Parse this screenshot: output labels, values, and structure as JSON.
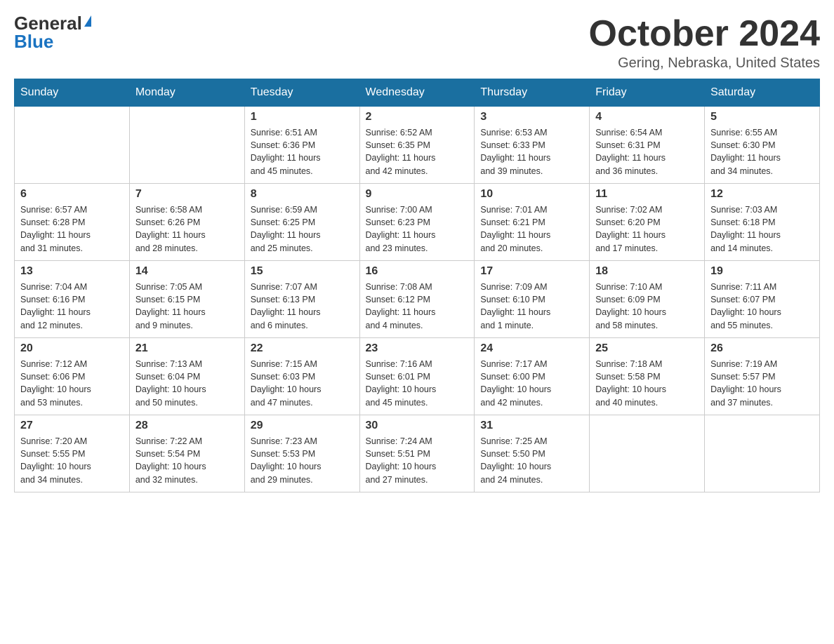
{
  "header": {
    "logo_general": "General",
    "logo_blue": "Blue",
    "title": "October 2024",
    "location": "Gering, Nebraska, United States"
  },
  "days_of_week": [
    "Sunday",
    "Monday",
    "Tuesday",
    "Wednesday",
    "Thursday",
    "Friday",
    "Saturday"
  ],
  "weeks": [
    [
      {
        "day": "",
        "info": ""
      },
      {
        "day": "",
        "info": ""
      },
      {
        "day": "1",
        "info": "Sunrise: 6:51 AM\nSunset: 6:36 PM\nDaylight: 11 hours\nand 45 minutes."
      },
      {
        "day": "2",
        "info": "Sunrise: 6:52 AM\nSunset: 6:35 PM\nDaylight: 11 hours\nand 42 minutes."
      },
      {
        "day": "3",
        "info": "Sunrise: 6:53 AM\nSunset: 6:33 PM\nDaylight: 11 hours\nand 39 minutes."
      },
      {
        "day": "4",
        "info": "Sunrise: 6:54 AM\nSunset: 6:31 PM\nDaylight: 11 hours\nand 36 minutes."
      },
      {
        "day": "5",
        "info": "Sunrise: 6:55 AM\nSunset: 6:30 PM\nDaylight: 11 hours\nand 34 minutes."
      }
    ],
    [
      {
        "day": "6",
        "info": "Sunrise: 6:57 AM\nSunset: 6:28 PM\nDaylight: 11 hours\nand 31 minutes."
      },
      {
        "day": "7",
        "info": "Sunrise: 6:58 AM\nSunset: 6:26 PM\nDaylight: 11 hours\nand 28 minutes."
      },
      {
        "day": "8",
        "info": "Sunrise: 6:59 AM\nSunset: 6:25 PM\nDaylight: 11 hours\nand 25 minutes."
      },
      {
        "day": "9",
        "info": "Sunrise: 7:00 AM\nSunset: 6:23 PM\nDaylight: 11 hours\nand 23 minutes."
      },
      {
        "day": "10",
        "info": "Sunrise: 7:01 AM\nSunset: 6:21 PM\nDaylight: 11 hours\nand 20 minutes."
      },
      {
        "day": "11",
        "info": "Sunrise: 7:02 AM\nSunset: 6:20 PM\nDaylight: 11 hours\nand 17 minutes."
      },
      {
        "day": "12",
        "info": "Sunrise: 7:03 AM\nSunset: 6:18 PM\nDaylight: 11 hours\nand 14 minutes."
      }
    ],
    [
      {
        "day": "13",
        "info": "Sunrise: 7:04 AM\nSunset: 6:16 PM\nDaylight: 11 hours\nand 12 minutes."
      },
      {
        "day": "14",
        "info": "Sunrise: 7:05 AM\nSunset: 6:15 PM\nDaylight: 11 hours\nand 9 minutes."
      },
      {
        "day": "15",
        "info": "Sunrise: 7:07 AM\nSunset: 6:13 PM\nDaylight: 11 hours\nand 6 minutes."
      },
      {
        "day": "16",
        "info": "Sunrise: 7:08 AM\nSunset: 6:12 PM\nDaylight: 11 hours\nand 4 minutes."
      },
      {
        "day": "17",
        "info": "Sunrise: 7:09 AM\nSunset: 6:10 PM\nDaylight: 11 hours\nand 1 minute."
      },
      {
        "day": "18",
        "info": "Sunrise: 7:10 AM\nSunset: 6:09 PM\nDaylight: 10 hours\nand 58 minutes."
      },
      {
        "day": "19",
        "info": "Sunrise: 7:11 AM\nSunset: 6:07 PM\nDaylight: 10 hours\nand 55 minutes."
      }
    ],
    [
      {
        "day": "20",
        "info": "Sunrise: 7:12 AM\nSunset: 6:06 PM\nDaylight: 10 hours\nand 53 minutes."
      },
      {
        "day": "21",
        "info": "Sunrise: 7:13 AM\nSunset: 6:04 PM\nDaylight: 10 hours\nand 50 minutes."
      },
      {
        "day": "22",
        "info": "Sunrise: 7:15 AM\nSunset: 6:03 PM\nDaylight: 10 hours\nand 47 minutes."
      },
      {
        "day": "23",
        "info": "Sunrise: 7:16 AM\nSunset: 6:01 PM\nDaylight: 10 hours\nand 45 minutes."
      },
      {
        "day": "24",
        "info": "Sunrise: 7:17 AM\nSunset: 6:00 PM\nDaylight: 10 hours\nand 42 minutes."
      },
      {
        "day": "25",
        "info": "Sunrise: 7:18 AM\nSunset: 5:58 PM\nDaylight: 10 hours\nand 40 minutes."
      },
      {
        "day": "26",
        "info": "Sunrise: 7:19 AM\nSunset: 5:57 PM\nDaylight: 10 hours\nand 37 minutes."
      }
    ],
    [
      {
        "day": "27",
        "info": "Sunrise: 7:20 AM\nSunset: 5:55 PM\nDaylight: 10 hours\nand 34 minutes."
      },
      {
        "day": "28",
        "info": "Sunrise: 7:22 AM\nSunset: 5:54 PM\nDaylight: 10 hours\nand 32 minutes."
      },
      {
        "day": "29",
        "info": "Sunrise: 7:23 AM\nSunset: 5:53 PM\nDaylight: 10 hours\nand 29 minutes."
      },
      {
        "day": "30",
        "info": "Sunrise: 7:24 AM\nSunset: 5:51 PM\nDaylight: 10 hours\nand 27 minutes."
      },
      {
        "day": "31",
        "info": "Sunrise: 7:25 AM\nSunset: 5:50 PM\nDaylight: 10 hours\nand 24 minutes."
      },
      {
        "day": "",
        "info": ""
      },
      {
        "day": "",
        "info": ""
      }
    ]
  ]
}
